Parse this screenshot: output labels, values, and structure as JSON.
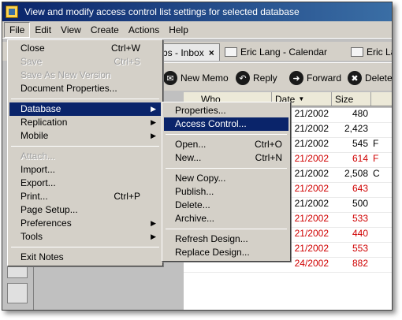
{
  "window": {
    "title": "View and modify access control list settings for selected database"
  },
  "menubar": {
    "items": [
      "File",
      "Edit",
      "View",
      "Create",
      "Actions",
      "Help"
    ]
  },
  "tabs": [
    {
      "label": "bs - Inbox",
      "close": "×"
    },
    {
      "label": "Eric Lang - Calendar"
    },
    {
      "label": "Eric La"
    }
  ],
  "actions": [
    {
      "label": "New Memo",
      "icon": "✉"
    },
    {
      "label": "Reply",
      "icon": "↶"
    },
    {
      "label": "Forward",
      "icon": "➜"
    },
    {
      "label": "Delete",
      "icon": "✖"
    }
  ],
  "view": {
    "columns": {
      "who": "Who",
      "date": "Date",
      "size": "Size"
    },
    "rows": [
      {
        "date": "21/2002",
        "size": "480",
        "extra": "",
        "red": false
      },
      {
        "date": "21/2002",
        "size": "2,423",
        "extra": "",
        "red": false
      },
      {
        "date": "21/2002",
        "size": "545",
        "extra": "F",
        "red": false
      },
      {
        "date": "21/2002",
        "size": "614",
        "extra": "F",
        "red": true
      },
      {
        "date": "21/2002",
        "size": "2,508",
        "extra": "C",
        "red": false
      },
      {
        "date": "21/2002",
        "size": "643",
        "extra": "",
        "red": true
      },
      {
        "date": "21/2002",
        "size": "500",
        "extra": "",
        "red": false
      },
      {
        "date": "21/2002",
        "size": "533",
        "extra": "",
        "red": true
      },
      {
        "date": "21/2002",
        "size": "440",
        "extra": "",
        "red": true
      },
      {
        "date": "21/2002",
        "size": "553",
        "extra": "",
        "red": true
      },
      {
        "date": "24/2002",
        "size": "882",
        "extra": "",
        "red": true
      }
    ]
  },
  "file_menu": {
    "close": "Close",
    "close_accel": "Ctrl+W",
    "save": "Save",
    "save_accel": "Ctrl+S",
    "save_new_version": "Save As New Version",
    "document_properties": "Document Properties...",
    "database": "Database",
    "replication": "Replication",
    "mobile": "Mobile",
    "attach": "Attach...",
    "import": "Import...",
    "export": "Export...",
    "print": "Print...",
    "print_accel": "Ctrl+P",
    "page_setup": "Page Setup...",
    "preferences": "Preferences",
    "tools": "Tools",
    "exit": "Exit Notes"
  },
  "database_menu": {
    "properties": "Properties...",
    "access_control": "Access Control...",
    "open": "Open...",
    "open_accel": "Ctrl+O",
    "new": "New...",
    "new_accel": "Ctrl+N",
    "new_copy": "New Copy...",
    "publish": "Publish...",
    "delete": "Delete...",
    "archive": "Archive...",
    "refresh_design": "Refresh Design...",
    "replace_design": "Replace Design..."
  }
}
